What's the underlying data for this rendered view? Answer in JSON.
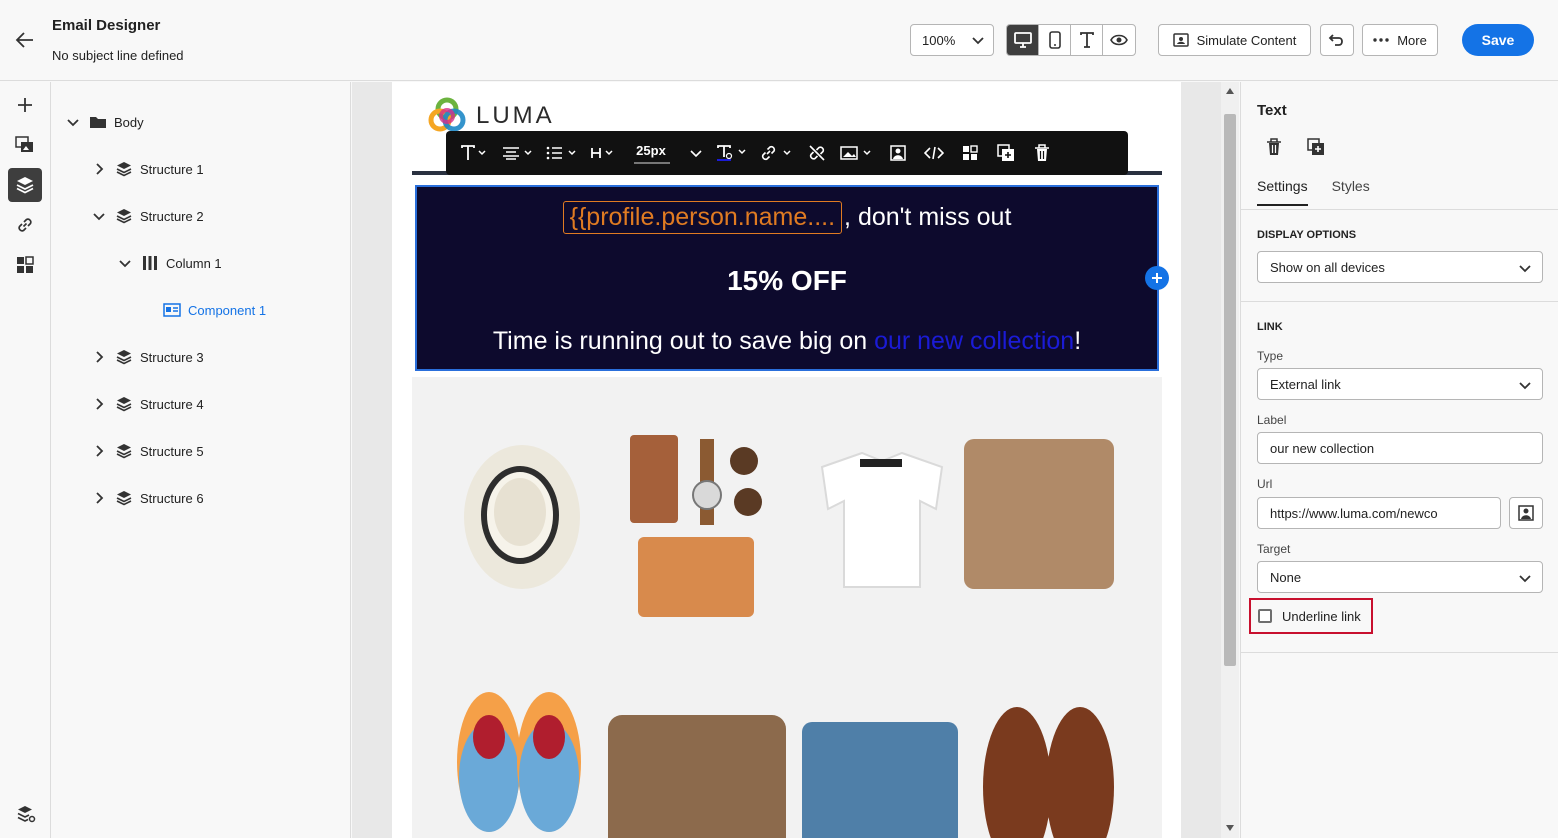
{
  "header": {
    "title": "Email Designer",
    "subject": "No subject line defined",
    "zoom": "100%",
    "simulate_label": "Simulate Content",
    "more_label": "More",
    "save_label": "Save"
  },
  "tree": {
    "items": [
      {
        "label": "Body"
      },
      {
        "label": "Structure 1"
      },
      {
        "label": "Structure 2"
      },
      {
        "label": "Column 1"
      },
      {
        "label": "Component 1"
      },
      {
        "label": "Structure 3"
      },
      {
        "label": "Structure 4"
      },
      {
        "label": "Structure 5"
      },
      {
        "label": "Structure 6"
      }
    ]
  },
  "canvas": {
    "logo_text": "LUMA",
    "font_size": "25px",
    "personalization": "{{profile.person.name....",
    "line1_rest": ", don't miss out",
    "line2": "15% OFF",
    "line3_pre": "Time is running out to save big on ",
    "line3_link": "our new collection",
    "line3_post": "!"
  },
  "panel": {
    "title": "Text",
    "tab_settings": "Settings",
    "tab_styles": "Styles",
    "display_options_title": "DISPLAY OPTIONS",
    "display_value": "Show on all devices",
    "link_title": "LINK",
    "type_label": "Type",
    "type_value": "External link",
    "label_label": "Label",
    "label_value": "our new collection",
    "url_label": "Url",
    "url_value": "https://www.luma.com/newco",
    "target_label": "Target",
    "target_value": "None",
    "underline_label": "Underline link",
    "underline_checked": false
  },
  "colors": {
    "accent": "#1473e6",
    "banner_bg": "#0d0a2d",
    "personalization": "#e07b22",
    "link": "#1b1bd6",
    "highlight": "#c8102e"
  }
}
